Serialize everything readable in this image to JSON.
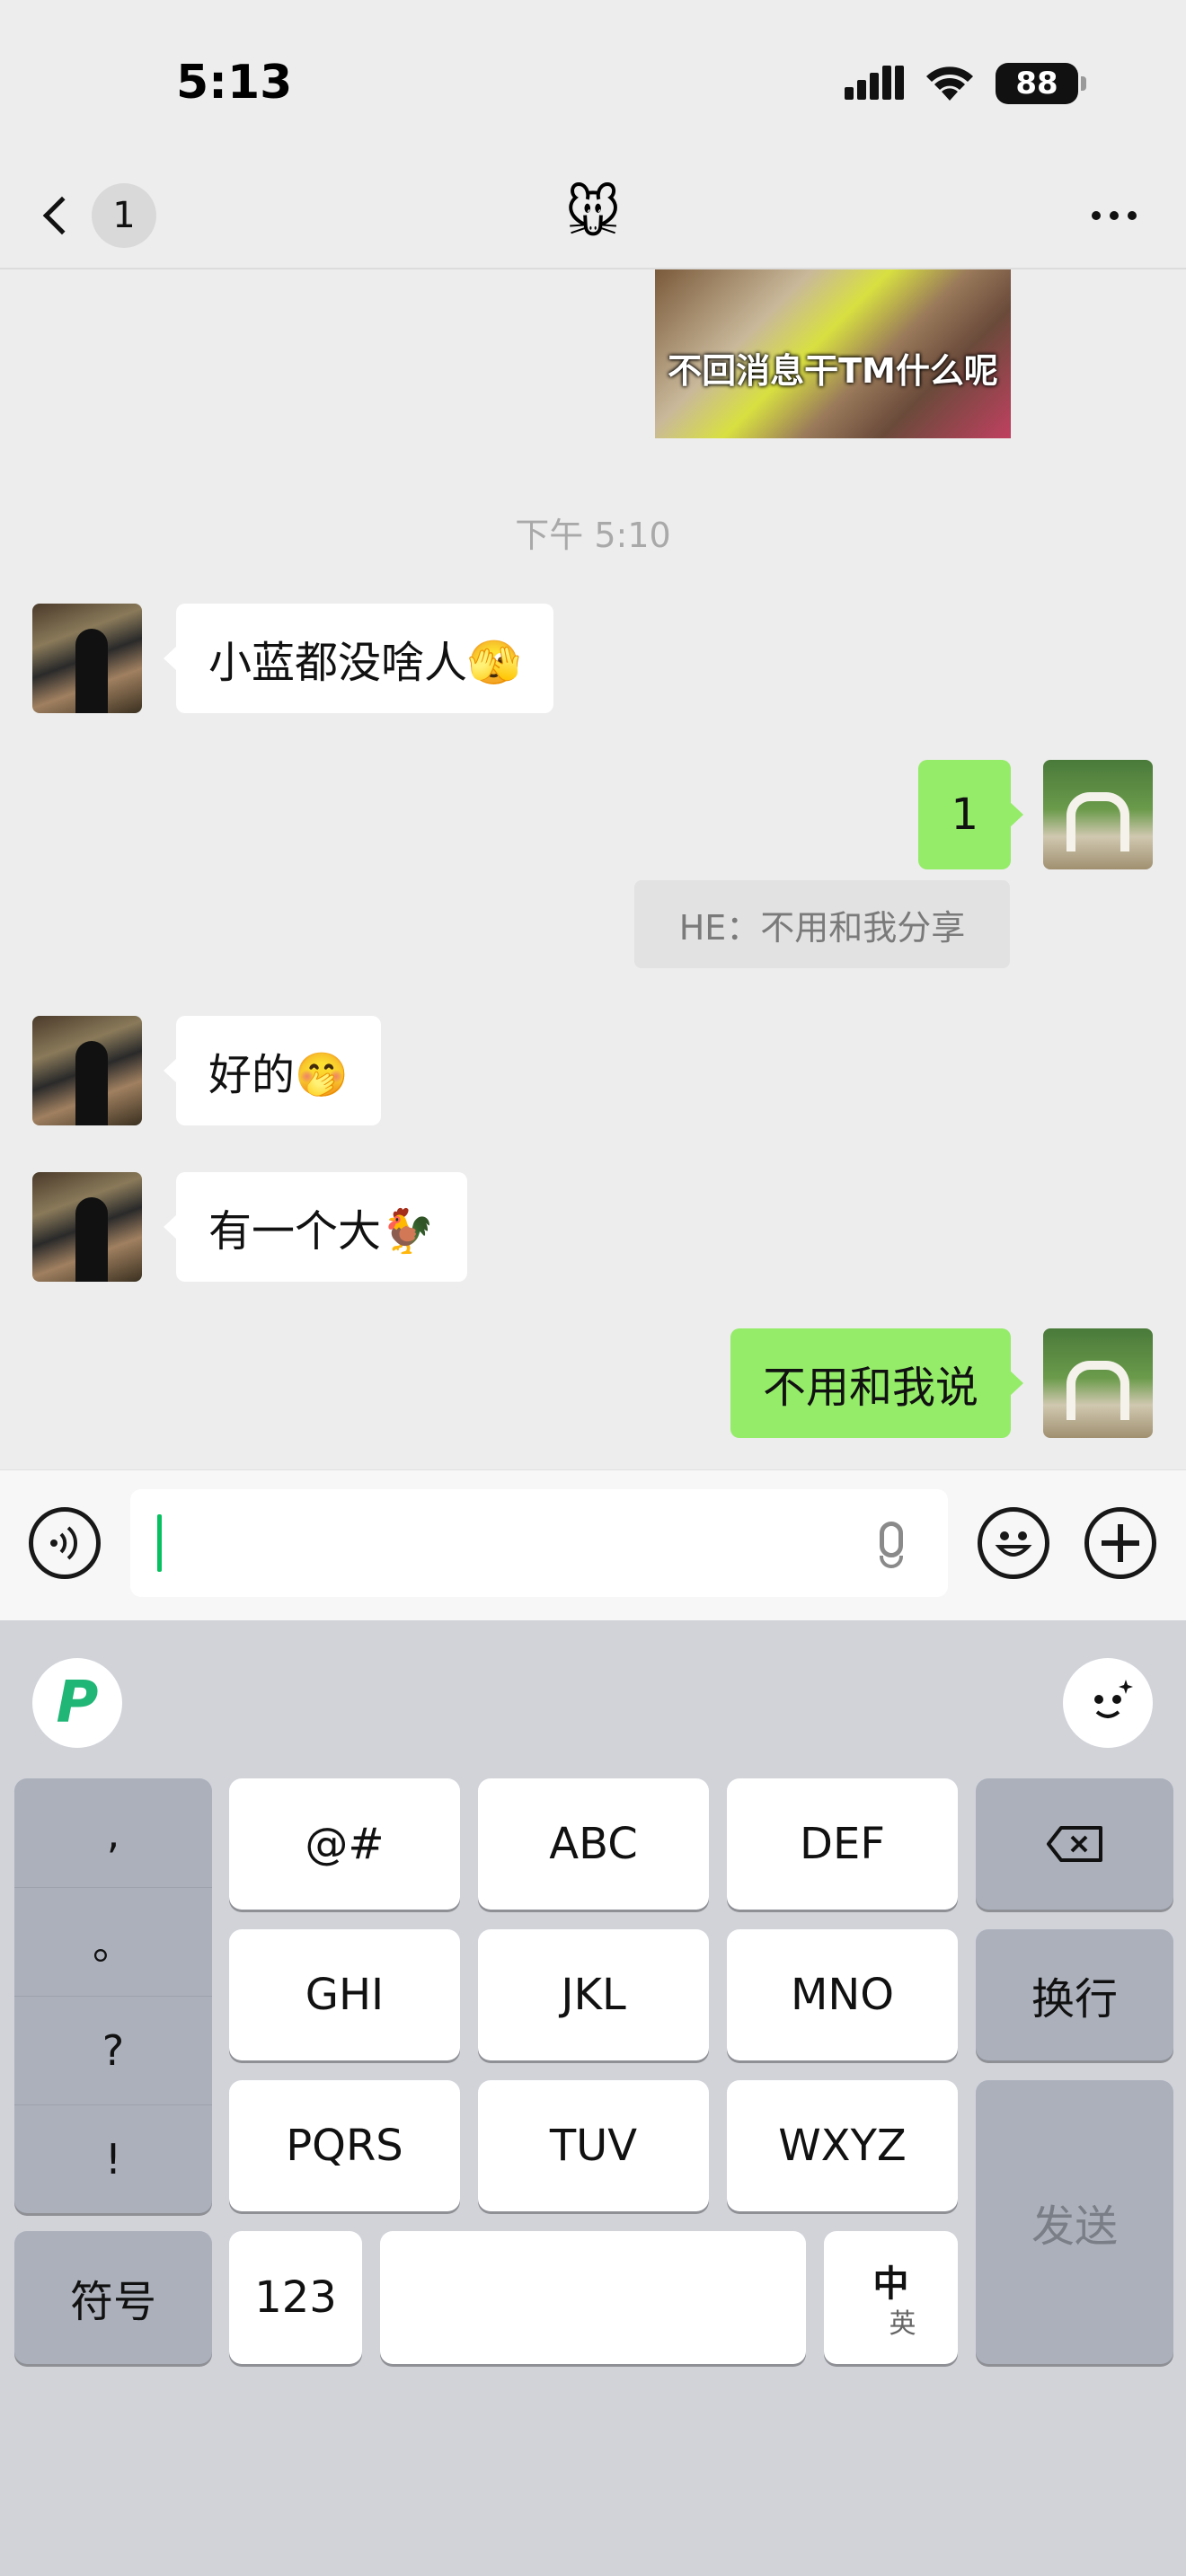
{
  "status_bar": {
    "time": "5:13",
    "battery": "88"
  },
  "navbar": {
    "unread_count": "1",
    "title": "🐭"
  },
  "chat": {
    "sticker_caption": "不回消息干TM什么呢",
    "timestamp": "下午 5:10",
    "messages": [
      {
        "side": "in",
        "text": "小蓝都没啥人🫣"
      },
      {
        "side": "out",
        "text": "1"
      },
      {
        "side": "in",
        "text": "好的🤭"
      },
      {
        "side": "in",
        "text": "有一个大🐓"
      },
      {
        "side": "out",
        "text": "不用和我说"
      }
    ],
    "quote": "HE：不用和我分享"
  },
  "input_bar": {
    "input_value": ""
  },
  "keyboard": {
    "punctuation": [
      ",",
      "。",
      "?",
      "!"
    ],
    "symbols_label": "符号",
    "rows": [
      [
        "@#",
        "ABC",
        "DEF"
      ],
      [
        "GHI",
        "JKL",
        "MNO"
      ],
      [
        "PQRS",
        "TUV",
        "WXYZ"
      ]
    ],
    "newline_label": "换行",
    "send_label": "发送",
    "numbers_label": "123",
    "lang_main": "中",
    "lang_sub": "英"
  }
}
